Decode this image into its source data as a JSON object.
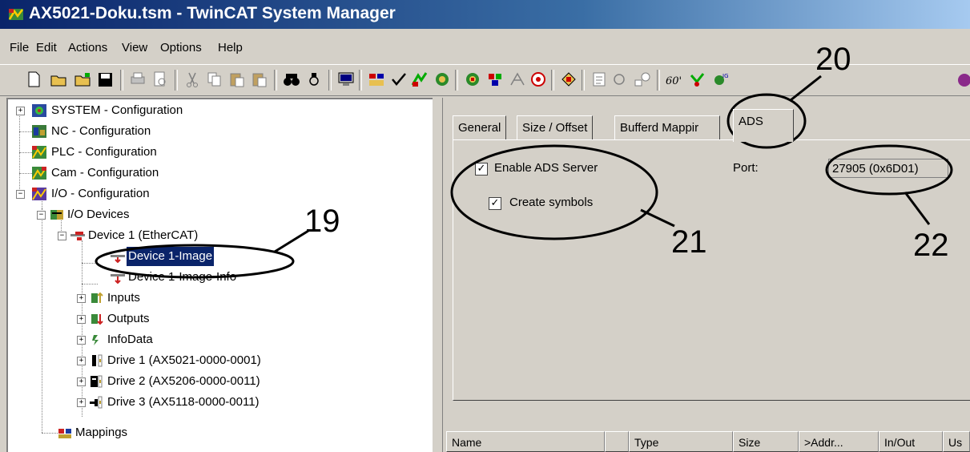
{
  "window": {
    "title": "AX5021-Doku.tsm - TwinCAT System Manager"
  },
  "menu": [
    "File",
    "Edit",
    "Actions",
    "View",
    "Options",
    "Help"
  ],
  "tree": {
    "nodes": [
      {
        "label": "SYSTEM - Configuration"
      },
      {
        "label": "NC - Configuration"
      },
      {
        "label": "PLC - Configuration"
      },
      {
        "label": "Cam - Configuration"
      },
      {
        "label": "I/O - Configuration"
      },
      {
        "label": "I/O Devices"
      },
      {
        "label": "Device 1 (EtherCAT)"
      },
      {
        "label": "Device 1-Image"
      },
      {
        "label": "Device 1-Image-Info"
      },
      {
        "label": "Inputs"
      },
      {
        "label": "Outputs"
      },
      {
        "label": "InfoData"
      },
      {
        "label": "Drive 1 (AX5021-0000-0001)"
      },
      {
        "label": "Drive 2 (AX5206-0000-0011)"
      },
      {
        "label": "Drive 3 (AX5118-0000-0011)"
      },
      {
        "label": "Mappings"
      }
    ]
  },
  "tabs": [
    "General",
    "Size / Offset",
    "Bufferd Mappir",
    "ADS"
  ],
  "ads": {
    "enable_label": "Enable ADS Server",
    "enable_checked": true,
    "symbols_label": "Create symbols",
    "symbols_checked": true,
    "port_label": "Port:",
    "port_value": "27905 (0x6D01)"
  },
  "list_columns": [
    "Name",
    "",
    "Type",
    "Size",
    ">Addr...",
    "In/Out",
    "Us"
  ],
  "callouts": {
    "n19": "19",
    "n20": "20",
    "n21": "21",
    "n22": "22"
  }
}
